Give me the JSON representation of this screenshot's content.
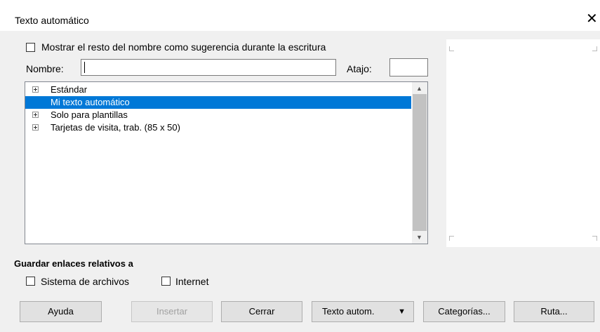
{
  "window": {
    "title": "Texto automático",
    "close_glyph": "✕"
  },
  "options": {
    "show_remainder_label": "Mostrar el resto del nombre como sugerencia durante la escritura",
    "show_remainder_checked": false
  },
  "fields": {
    "name_label": "Nombre:",
    "name_value": "",
    "shortcut_label": "Atajo:",
    "shortcut_value": ""
  },
  "list": {
    "items": [
      {
        "label": "Estándar",
        "expandable": true,
        "selected": false
      },
      {
        "label": "Mi texto automático",
        "expandable": false,
        "selected": true
      },
      {
        "label": "Solo para plantillas",
        "expandable": true,
        "selected": false
      },
      {
        "label": "Tarjetas de visita, trab. (85 x 50)",
        "expandable": true,
        "selected": false
      }
    ]
  },
  "links": {
    "section_title": "Guardar enlaces relativos a",
    "filesystem_label": "Sistema de archivos",
    "internet_label": "Internet"
  },
  "buttons": {
    "help": "Ayuda",
    "insert": "Insertar",
    "close": "Cerrar",
    "autotext": "Texto autom.",
    "categories": "Categorías...",
    "path": "Ruta..."
  },
  "colors": {
    "selection": "#0078d7",
    "dialog_bg": "#f0f0f0"
  }
}
